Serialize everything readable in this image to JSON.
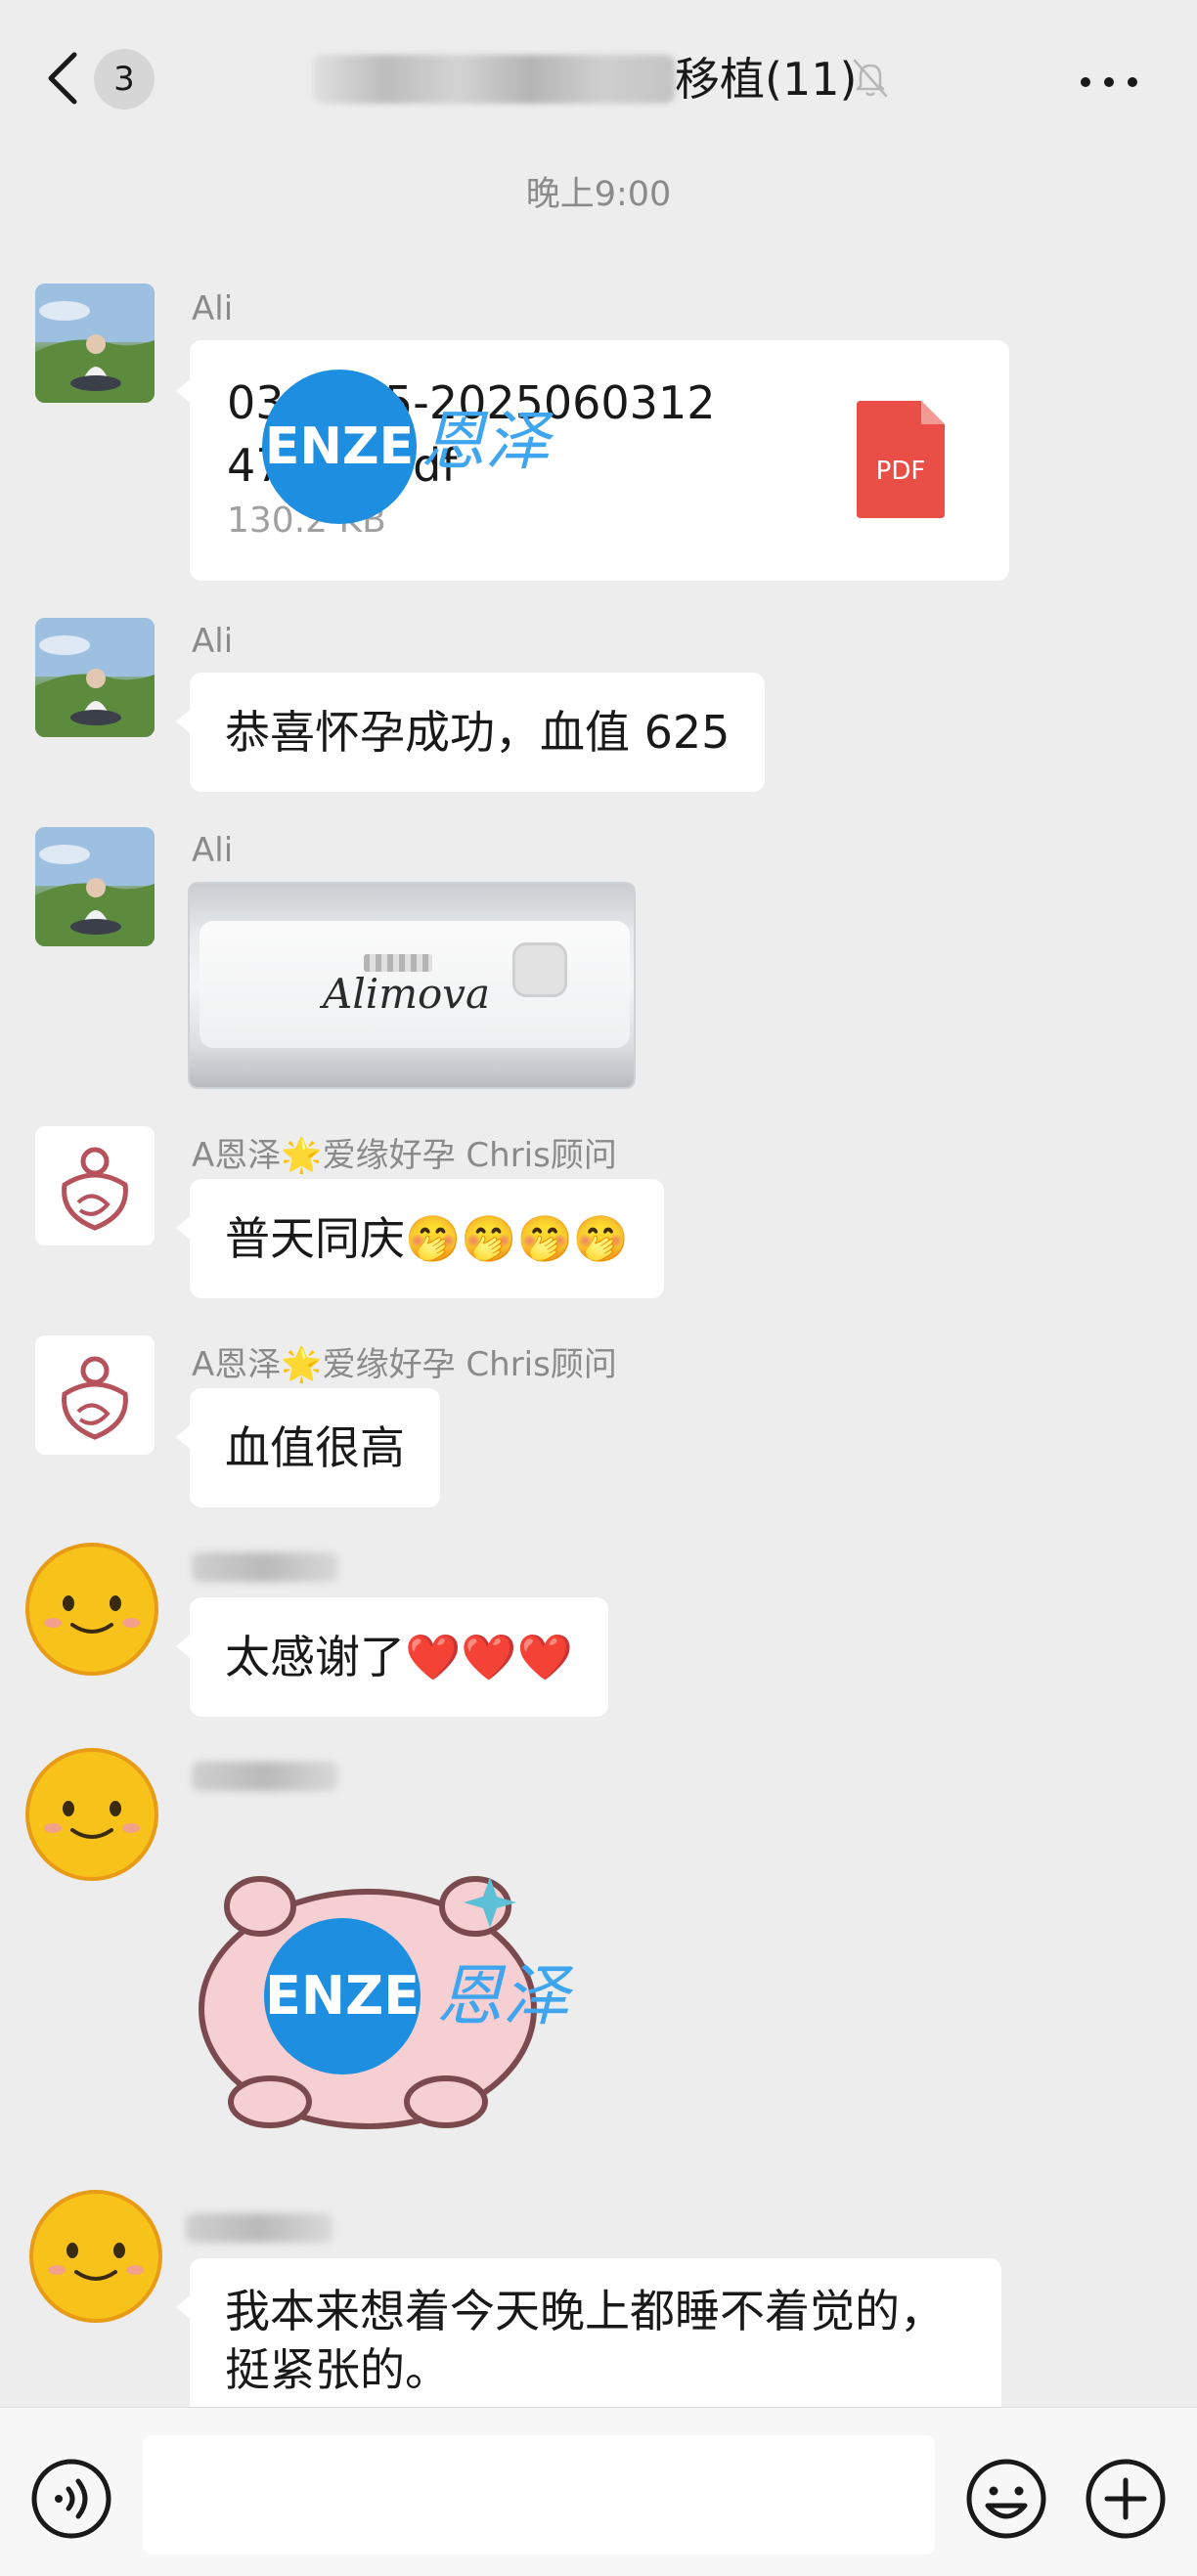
{
  "header": {
    "back_label": "back",
    "unread_count": "3",
    "title": "移植(11)",
    "icons": {
      "back": "chevron-left-icon",
      "mute": "bell-off-icon",
      "more": "more-dots-icon"
    }
  },
  "timestamp": "晚上9:00",
  "messages": [
    {
      "type": "file",
      "sender": "Ali",
      "file_name_line1": "03 2025-2025060312",
      "file_name_line2": "47 27 .pdf",
      "file_size": "130.2 KB",
      "file_type": "PDF"
    },
    {
      "type": "text",
      "sender": "Ali",
      "text": "恭喜怀孕成功，血值 625"
    },
    {
      "type": "image",
      "sender": "Ali",
      "image_text": "Alimova"
    },
    {
      "type": "text",
      "sender": "A恩泽🌟爱缘好孕 Chris顾问",
      "text": "普天同庆🤭🤭🤭🤭"
    },
    {
      "type": "text",
      "sender": "A恩泽🌟爱缘好孕 Chris顾问",
      "text": "血值很高"
    },
    {
      "type": "text",
      "sender": "",
      "text": "太感谢了❤️❤️❤️"
    },
    {
      "type": "sticker",
      "sender": ""
    },
    {
      "type": "text",
      "sender": "",
      "text_line1": "我本来想着今天晚上都睡不着觉的，",
      "text_line2": "挺紧张的。"
    }
  ],
  "watermark": {
    "circle_text": "ENZE",
    "script_text": "恩泽"
  },
  "input_bar": {
    "icons": {
      "voice": "voice-icon",
      "emoji": "emoji-icon",
      "plus": "plus-icon"
    }
  },
  "colors": {
    "background": "#ededed",
    "bubble": "#ffffff",
    "pdf_red": "#e94f46",
    "watermark_blue": "#1e8fe0"
  }
}
